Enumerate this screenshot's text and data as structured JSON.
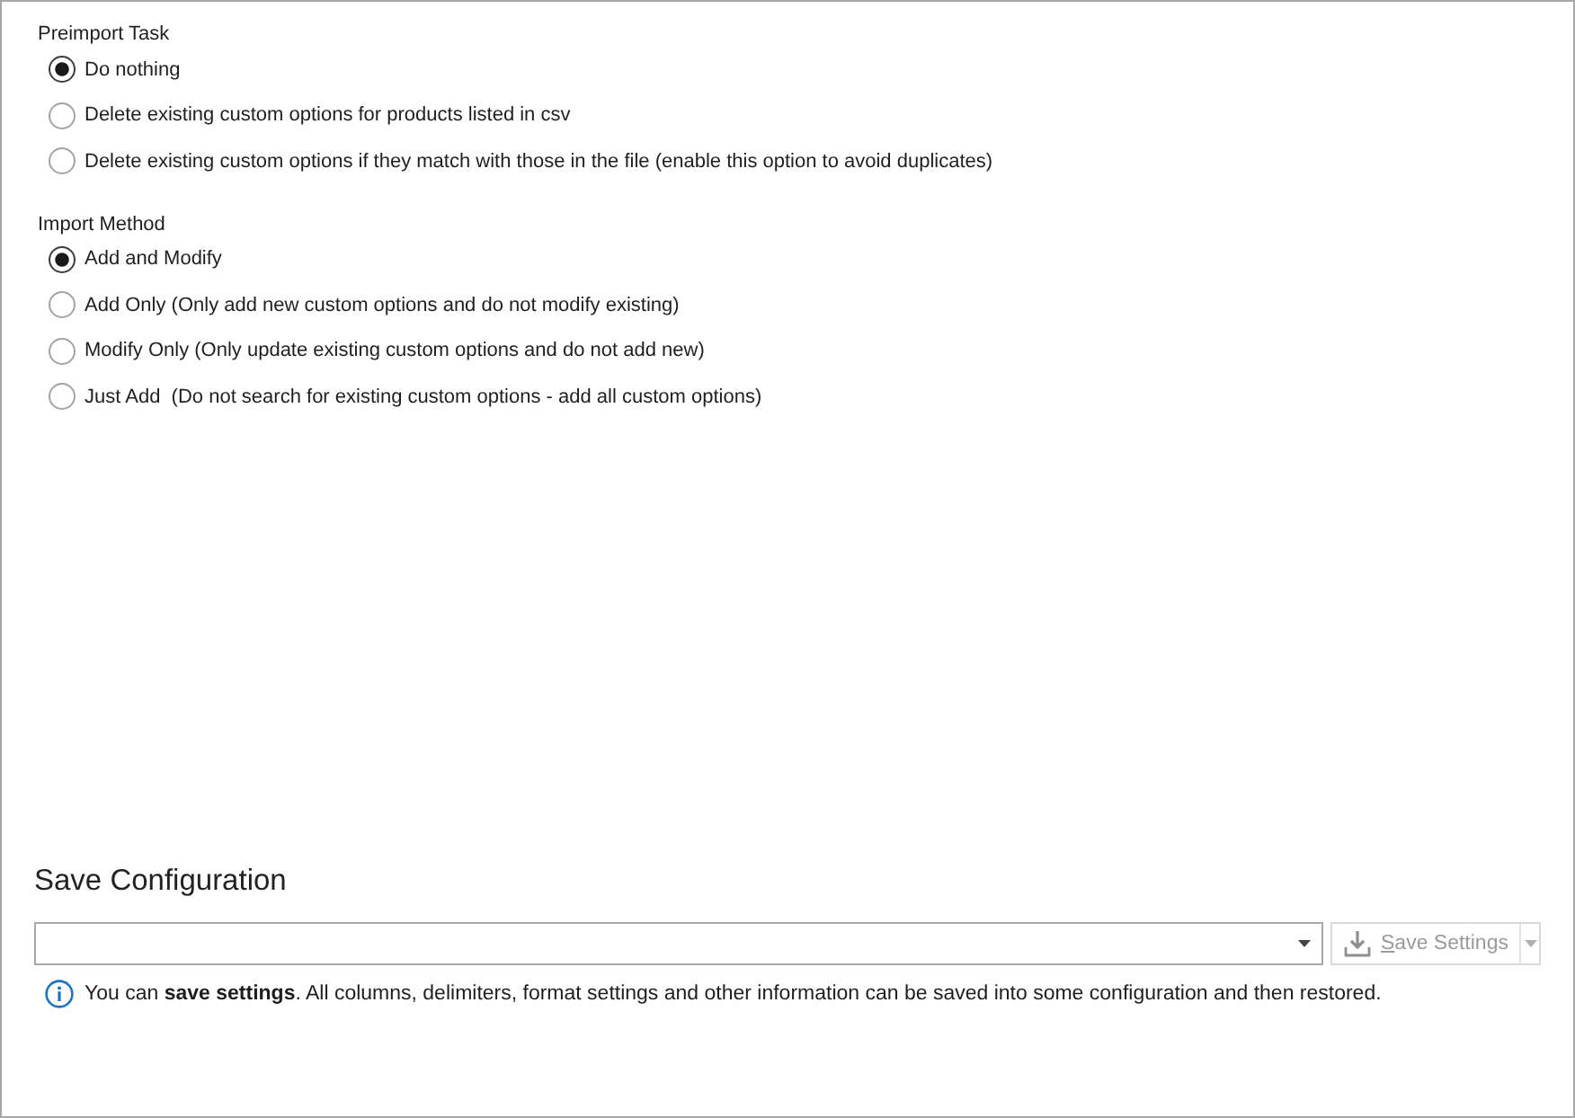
{
  "groups": [
    {
      "title": "Preimport Task",
      "options": [
        {
          "label": "Do nothing",
          "selected": true
        },
        {
          "label": "Delete existing custom options for products listed in csv",
          "selected": false
        },
        {
          "label": "Delete existing custom options if they match with those in the file (enable this option to avoid duplicates)",
          "selected": false
        }
      ]
    },
    {
      "title": "Import Method",
      "options": [
        {
          "label": "Add and Modify",
          "selected": true
        },
        {
          "label": "Add Only (Only add new custom options and do not modify existing)",
          "selected": false
        },
        {
          "label": "Modify Only (Only update existing custom options and do not add new)",
          "selected": false
        },
        {
          "label": "Just Add  (Do not search for existing custom options - add all custom options)",
          "selected": false
        }
      ]
    }
  ],
  "save_configuration": {
    "title": "Save Configuration",
    "save_button": {
      "label": "Save Settings",
      "disabled": true
    },
    "info": "You can **save settings**. All columns, delimiters, format settings and other information can be saved into some configuration and then restored."
  }
}
